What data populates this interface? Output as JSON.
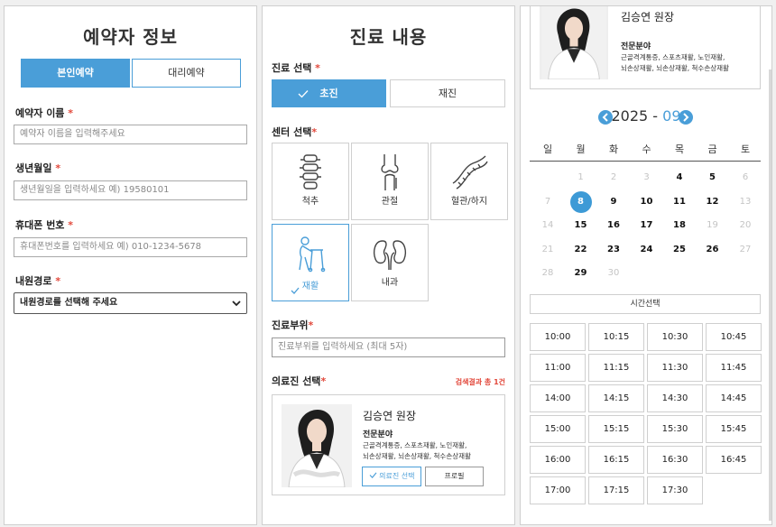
{
  "booker": {
    "title": "예약자 정보",
    "tab_self": "본인예약",
    "tab_proxy": "대리예약",
    "name_label": "예약자 이름",
    "name_placeholder": "예약자 이름을 입력해주세요",
    "birth_label": "생년월일",
    "birth_placeholder": "생년월일을 입력하세요   예) 19580101",
    "phone_label": "휴대폰 번호",
    "phone_placeholder": "휴대폰번호를 입력하세요   예) 010-1234-5678",
    "route_label": "내원경로",
    "route_value": "내원경로를 선택해 주세요",
    "required_mark": "*"
  },
  "treatment": {
    "title": "진료 내용",
    "type_label": "진료 선택",
    "type_first": "초진",
    "type_return": "재진",
    "center_label": "센터 선택",
    "centers": [
      "척추",
      "관절",
      "혈관/하지",
      "재활",
      "내과"
    ],
    "selected_center": "재활",
    "area_label": "진료부위",
    "area_placeholder": "진료부위를 입력하세요 (최대 5자)",
    "doctor_label": "의료진 선택",
    "result_count": "검색결과 총 1건",
    "required_mark": "*"
  },
  "doctor": {
    "name": "김승연 원장",
    "specialty_label": "전문분야",
    "specialty_lines": [
      "근골격계통증, 스포츠재활, 노인재활,",
      "뇌손상재활, 뇌손상재활, 척수손상재활"
    ],
    "specialty_lines_top": [
      "근골격계통증, 스포츠재활, 노인재활,",
      "뇌손상재활, 뇌손상재활, 척수손상재활"
    ],
    "select_button": "의료진 선택",
    "profile_button": "프로필"
  },
  "calendar": {
    "year": "2025",
    "separator": " - ",
    "month": "09",
    "weekdays": [
      "일",
      "월",
      "화",
      "수",
      "목",
      "금",
      "토"
    ],
    "weeks": [
      [
        "",
        "1",
        "2",
        "3",
        "4",
        "5",
        "6"
      ],
      [
        "7",
        "8",
        "9",
        "10",
        "11",
        "12",
        "13"
      ],
      [
        "14",
        "15",
        "16",
        "17",
        "18",
        "19",
        "20"
      ],
      [
        "21",
        "22",
        "23",
        "24",
        "25",
        "26",
        "27"
      ],
      [
        "28",
        "29",
        "30",
        "",
        "",
        "",
        ""
      ]
    ],
    "today": "8",
    "available": [
      "4",
      "5",
      "9",
      "10",
      "11",
      "12",
      "15",
      "16",
      "17",
      "18",
      "22",
      "23",
      "24",
      "25",
      "26",
      "29"
    ],
    "time_label": "시간선택",
    "times": [
      "10:00",
      "10:15",
      "10:30",
      "10:45",
      "11:00",
      "11:15",
      "11:30",
      "11:45",
      "14:00",
      "14:15",
      "14:30",
      "14:45",
      "15:00",
      "15:15",
      "15:30",
      "15:45",
      "16:00",
      "16:15",
      "16:30",
      "16:45",
      "17:00",
      "17:15",
      "17:30"
    ]
  },
  "colors": {
    "accent": "#4a9ed8",
    "required": "#e2483b",
    "border": "#cfcfcf"
  }
}
